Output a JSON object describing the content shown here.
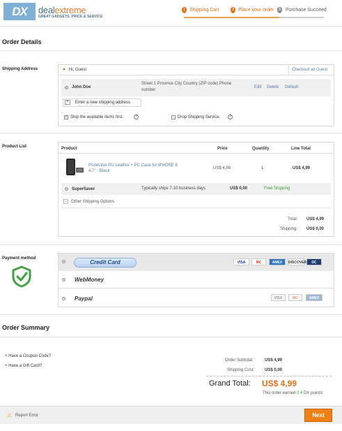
{
  "header": {
    "logo_text": "DX",
    "brand_a": "deal",
    "brand_b": "extreme",
    "tagline": "GREAT GADGETS. PRICE & SERVICE",
    "steps": [
      {
        "num": "1",
        "label": "Shipping Cart",
        "color": "#e86d15"
      },
      {
        "num": "2",
        "label": "Place your order",
        "color": "#e86d15"
      },
      {
        "num": "3",
        "label": "Purchase Succeed",
        "color": "#666666"
      }
    ]
  },
  "order_details": {
    "title": "Order Details",
    "shipping_address": {
      "label": "Shipping Address",
      "greeting": "Hi, Guest",
      "checkout_guest": "Checkout as Guest",
      "name": "John Doe",
      "address_line1": "Street 1 Province City Country (ZIP code) Phone",
      "address_line2": "number",
      "edit": "Edit",
      "delete": "Delete",
      "default": "Default",
      "add_new": "Enter a new shipping address",
      "ship_available": "Ship the available items first.",
      "drop_shipping": "Drop Shipping Service."
    },
    "product_list": {
      "label": "Product List",
      "headers": {
        "product": "Product",
        "price": "Price",
        "quantity": "Quantity",
        "line_total": "Line Total"
      },
      "item": {
        "name_line1": "Protective PU Leather + PC Case for IPHONE 6",
        "name_line2": "4.7\" - Black",
        "price": "US$ 4,99",
        "quantity": "1",
        "line_total": "US$ 4,99"
      },
      "shipping": {
        "method": "SuperSaver",
        "eta": "Typically ships 7-10 business days",
        "cost": "US$ 0,00",
        "note": "Free Shipping"
      },
      "other_options": "Other Shipping Options",
      "total_label": "Total:",
      "total_value": "US$ 4,99",
      "shipping_label": "Shipping:",
      "shipping_value": "US$ 0,00"
    },
    "payment": {
      "label": "Payment method",
      "credit_card": "Credit Card",
      "webmoney": "WebMoney",
      "paypal": "Paypal",
      "cards": [
        "VISA",
        "MC",
        "AMEX",
        "DISCOVER",
        "DC"
      ],
      "paypal_cards": [
        "VISA",
        "MC",
        "AMEX"
      ]
    }
  },
  "summary": {
    "title": "Order Summary",
    "coupon": "Have a Coupon Code?",
    "gift": "Have a Gift Card?",
    "subtotal_label": "Order Subtotal:",
    "subtotal_value": "US$ 4,99",
    "shipcost_label": "Shipping Cost:",
    "shipcost_value": "US$ 0,00",
    "grand_label": "Grand Total:",
    "grand_value": "US$ 4,99",
    "points_prefix": "This order earned",
    "points_value": "0,4",
    "points_suffix": "DX points!"
  },
  "footer": {
    "report_error": "Report Error",
    "next": "Next"
  }
}
